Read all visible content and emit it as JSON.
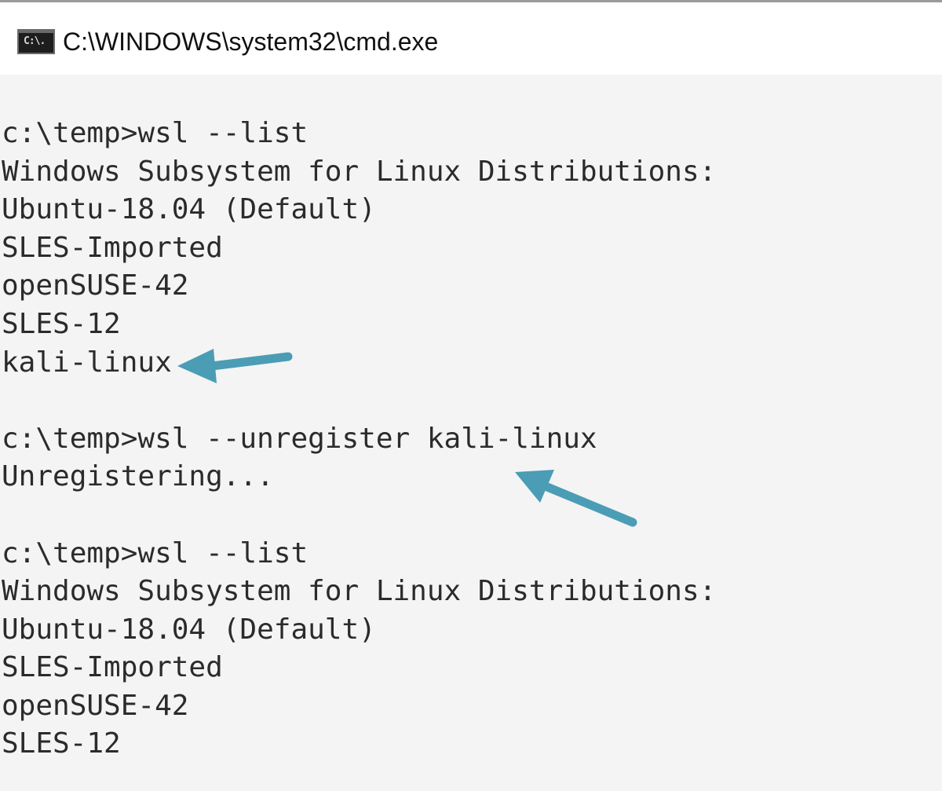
{
  "window": {
    "title": "C:\\WINDOWS\\system32\\cmd.exe",
    "icon": "cmd-icon",
    "icon_text": "C:\\."
  },
  "console": {
    "lines": [
      "c:\\temp>wsl --list",
      "Windows Subsystem for Linux Distributions:",
      "Ubuntu-18.04 (Default)",
      "SLES-Imported",
      "openSUSE-42",
      "SLES-12",
      "kali-linux",
      "",
      "c:\\temp>wsl --unregister kali-linux",
      "Unregistering...",
      "",
      "c:\\temp>wsl --list",
      "Windows Subsystem for Linux Distributions:",
      "Ubuntu-18.04 (Default)",
      "SLES-Imported",
      "openSUSE-42",
      "SLES-12"
    ]
  },
  "annotations": {
    "arrow_color": "#4a9db5",
    "arrows": [
      "arrow-pointing-to-kali-linux",
      "arrow-pointing-to-unregister-command"
    ]
  }
}
